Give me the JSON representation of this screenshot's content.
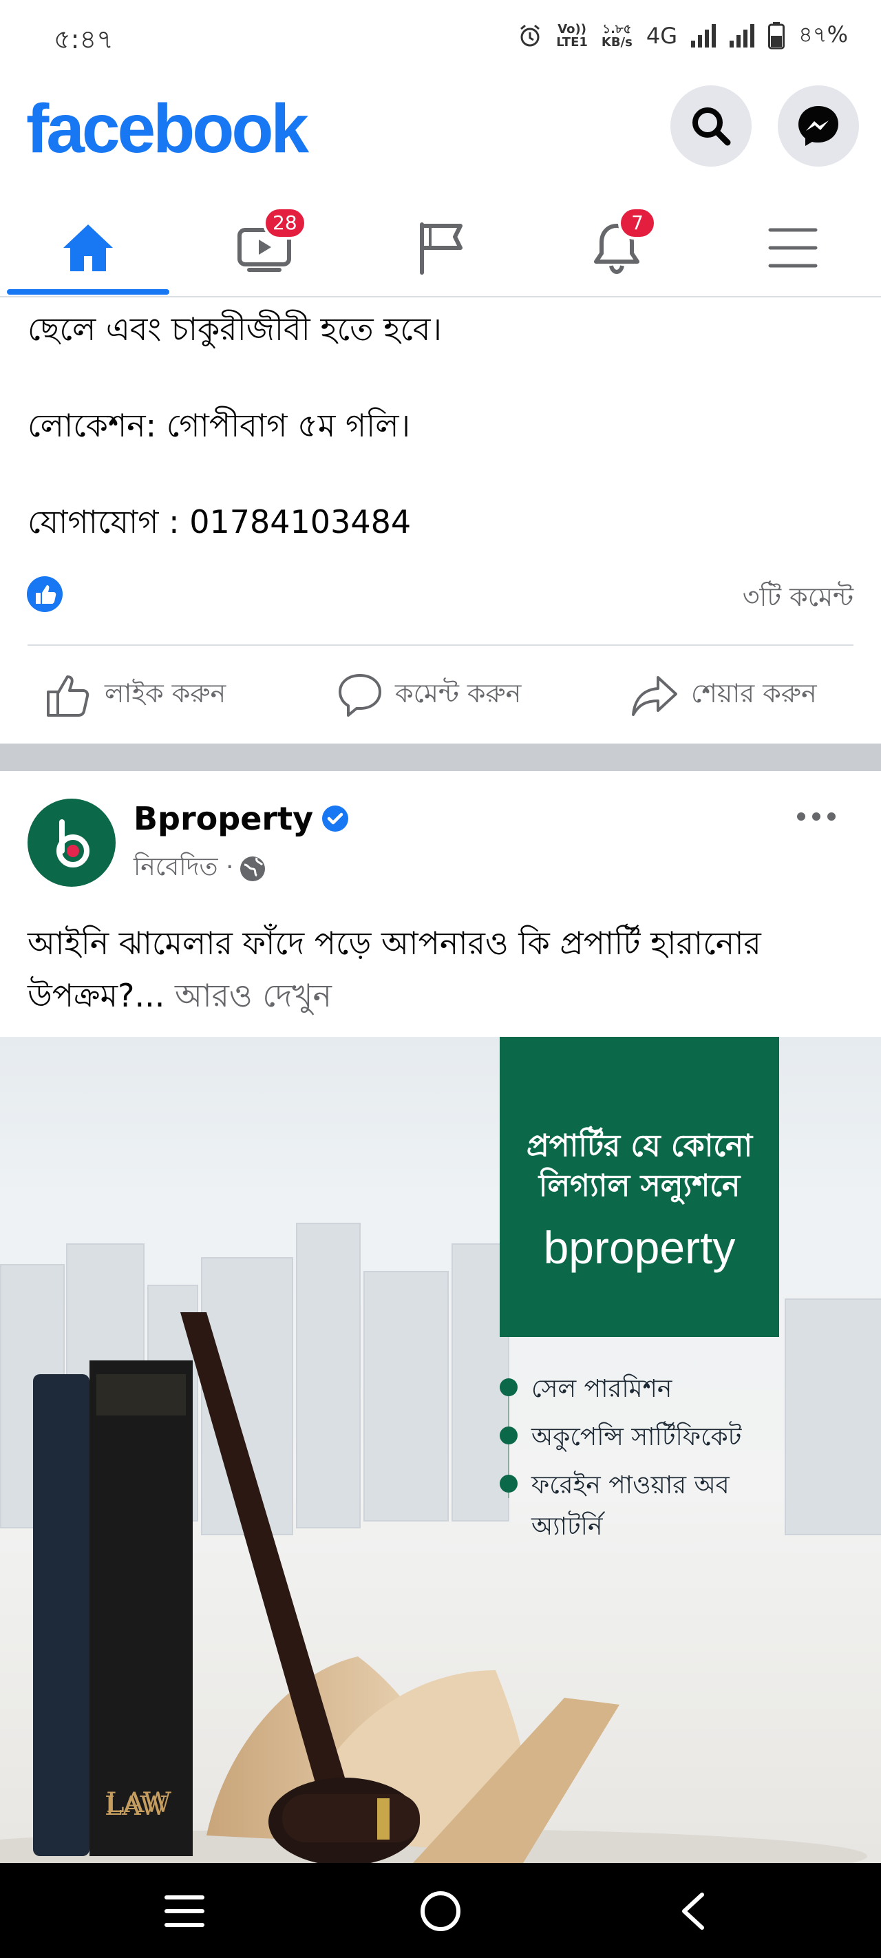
{
  "status_bar": {
    "time": "৫:৪৭",
    "volte_top": "Vo))",
    "volte_bottom": "LTE1",
    "speed_top": "১.৮৫",
    "speed_bottom": "KB/s",
    "network": "4G",
    "battery": "৪৭%"
  },
  "header": {
    "logo": "facebook",
    "search_icon": "search-icon",
    "messenger_icon": "messenger-icon",
    "brand_color": "#1877f2"
  },
  "nav": {
    "items": [
      {
        "name": "home",
        "icon": "home-icon",
        "active": true
      },
      {
        "name": "watch",
        "icon": "video-icon",
        "badge": "28"
      },
      {
        "name": "pages",
        "icon": "flag-icon"
      },
      {
        "name": "notifications",
        "icon": "bell-icon",
        "badge": "7"
      },
      {
        "name": "menu",
        "icon": "hamburger-icon"
      }
    ]
  },
  "post1": {
    "lines": [
      "ছেলে এবং চাকুরীজীবী হতে হবে।",
      "লোকেশন: গোপীবাগ ৫ম গলি।",
      "যোগাযোগ : 01784103484"
    ],
    "comment_count": "৩টি কমেন্ট",
    "actions": {
      "like": "লাইক করুন",
      "comment": "কমেন্ট করুন",
      "share": "শেয়ার করুন"
    }
  },
  "post2": {
    "page_name": "Bproperty",
    "sponsored": "নিবেদিত ·",
    "text": "আইনি ঝামেলার ফাঁদে পড়ে আপনারও কি প্রপার্টি হারানোর",
    "text_line2": "উপক্রম?...",
    "see_more": "আরও দেখুন",
    "ad": {
      "headline_1": "প্রপার্টির যে কোনো",
      "headline_2": "লিগ্যাল সল্যুশনে",
      "brand": "bproperty",
      "book_label": "LAW",
      "bullets": [
        "সেল পারমিশন",
        "অকুপেন্সি সার্টিফিকেট",
        "ফরেইন পাওয়ার অব অ্যাটর্নি"
      ]
    }
  },
  "system_nav": {
    "recents_icon": "recents-icon",
    "home_icon": "circle-home-icon",
    "back_icon": "back-icon"
  }
}
